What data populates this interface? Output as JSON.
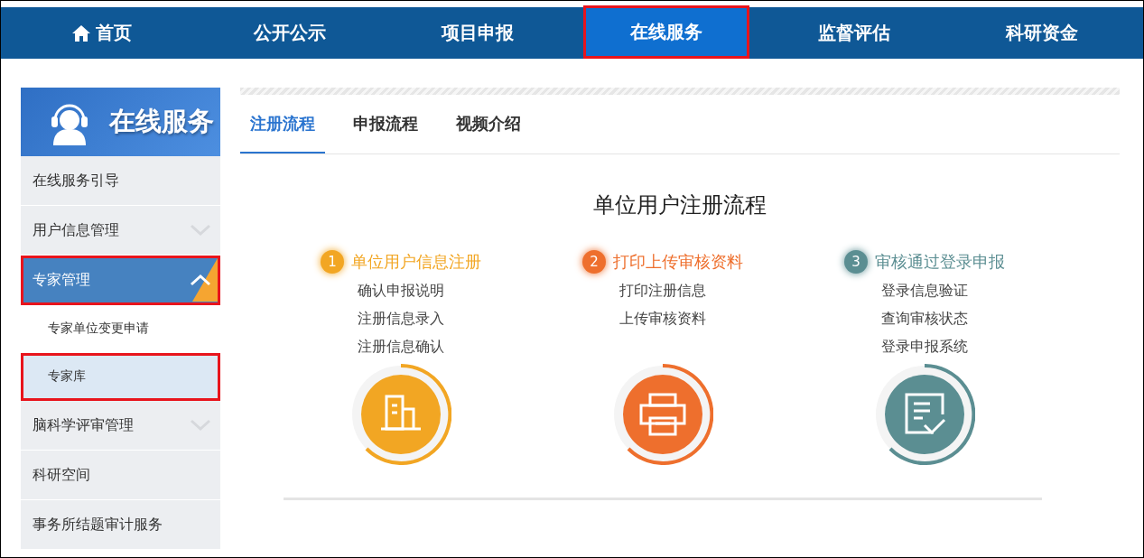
{
  "nav": [
    {
      "label": "首页",
      "selected": false,
      "highlighted": false
    },
    {
      "label": "公开公示",
      "selected": false,
      "highlighted": false
    },
    {
      "label": "项目申报",
      "selected": false,
      "highlighted": false
    },
    {
      "label": "在线服务",
      "selected": true,
      "highlighted": true
    },
    {
      "label": "监督评估",
      "selected": false,
      "highlighted": false
    },
    {
      "label": "科研资金",
      "selected": false,
      "highlighted": false
    }
  ],
  "sidebar": {
    "title": "在线服务",
    "items": [
      {
        "kind": "item",
        "label": "在线服务引导",
        "selected": false,
        "highlighted": false
      },
      {
        "kind": "group",
        "label": "用户信息管理",
        "expanded": false,
        "selected": false,
        "highlighted": false
      },
      {
        "kind": "group",
        "label": "专家管理",
        "expanded": true,
        "selected": true,
        "highlighted": true
      },
      {
        "kind": "sub",
        "label": "专家单位变更申请",
        "selected": false,
        "highlighted": false
      },
      {
        "kind": "sub",
        "label": "专家库",
        "selected": true,
        "highlighted": true
      },
      {
        "kind": "group",
        "label": "脑科学评审管理",
        "expanded": false,
        "selected": false,
        "highlighted": false
      },
      {
        "kind": "item",
        "label": "科研空间",
        "selected": false,
        "highlighted": false
      },
      {
        "kind": "item",
        "label": "事务所结题审计服务",
        "selected": false,
        "highlighted": false
      }
    ]
  },
  "tabs": [
    {
      "label": "注册流程",
      "selected": true
    },
    {
      "label": "申报流程",
      "selected": false
    },
    {
      "label": "视频介绍",
      "selected": false
    }
  ],
  "flow": {
    "title": "单位用户注册流程",
    "steps": [
      {
        "number": "1",
        "title": "单位用户信息注册",
        "color": "#f2a623",
        "lines": [
          "确认申报说明",
          "注册信息录入",
          "注册信息确认"
        ]
      },
      {
        "number": "2",
        "title": "打印上传审核资料",
        "color": "#ee6f2d",
        "lines": [
          "打印注册信息",
          "上传审核资料"
        ]
      },
      {
        "number": "3",
        "title": "审核通过登录申报",
        "color": "#5b8e92",
        "lines": [
          "登录信息验证",
          "查询审核状态",
          "登录申报系统"
        ]
      }
    ]
  }
}
